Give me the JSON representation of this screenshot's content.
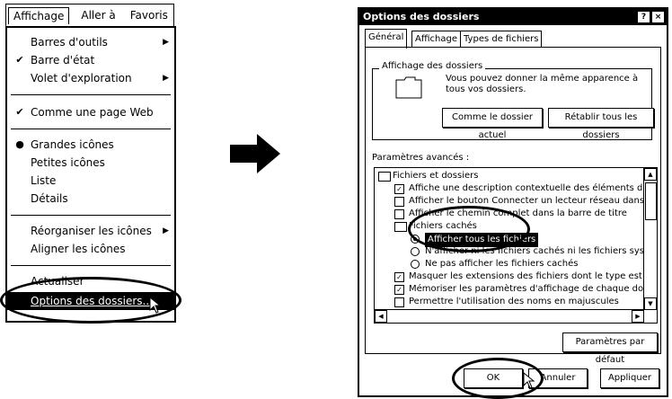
{
  "menubar": {
    "items": [
      "Affichage",
      "Aller à",
      "Favoris"
    ]
  },
  "menu": {
    "items": [
      {
        "label": "Barres d'outils",
        "checked": false,
        "submenu": true
      },
      {
        "label": "Barre d'état",
        "checked": true,
        "submenu": false
      },
      {
        "label": "Volet d'exploration",
        "checked": false,
        "submenu": true
      },
      {
        "label": "Comme une page Web",
        "checked": true,
        "submenu": false
      },
      {
        "label": "Grandes icônes",
        "radio": true,
        "submenu": false
      },
      {
        "label": "Petites icônes",
        "submenu": false
      },
      {
        "label": "Liste",
        "submenu": false
      },
      {
        "label": "Détails",
        "submenu": false
      },
      {
        "label": "Réorganiser les icônes",
        "submenu": true
      },
      {
        "label": "Aligner les icônes",
        "submenu": false
      },
      {
        "label": "Actualiser",
        "submenu": false
      },
      {
        "label": "Options des dossiers...",
        "submenu": false,
        "highlighted": true
      }
    ]
  },
  "dialog": {
    "title": "Options des dossiers",
    "help_button": "?",
    "close_button": "×",
    "tabs": [
      "Général",
      "Affichage",
      "Types de fichiers"
    ],
    "group_title": "Affichage des dossiers",
    "group_text": "Vous pouvez donner la même apparence à tous vos dossiers.",
    "btn_current": "Comme le dossier actuel",
    "btn_reset_all": "Rétablir tous les dossiers",
    "advanced_label": "Paramètres avancés :",
    "tree": [
      {
        "kind": "folder",
        "label": "Fichiers et dossiers",
        "indent": 0
      },
      {
        "kind": "check",
        "checked": true,
        "label": "Affiche une description contextuelle des éléments du Bure",
        "indent": 1
      },
      {
        "kind": "check",
        "checked": false,
        "label": "Afficher le bouton Connecter un lecteur réseau dans la ba",
        "indent": 1
      },
      {
        "kind": "check",
        "checked": false,
        "label": "Afficher le chemin complet dans la barre de titre",
        "indent": 1
      },
      {
        "kind": "folder",
        "label": "Fichiers cachés",
        "indent": 1
      },
      {
        "kind": "radio",
        "on": true,
        "label": "Afficher tous les fichiers",
        "indent": 2,
        "selected": true
      },
      {
        "kind": "radio",
        "on": false,
        "label": "N'afficher ni les fichiers cachés ni les fichiers système",
        "indent": 2
      },
      {
        "kind": "radio",
        "on": false,
        "label": "Ne pas afficher les fichiers cachés",
        "indent": 2
      },
      {
        "kind": "check",
        "checked": true,
        "label": "Masquer les extensions des fichiers dont le type est conn",
        "indent": 1
      },
      {
        "kind": "check",
        "checked": true,
        "label": "Mémoriser les paramètres d'affichage de chaque dossier",
        "indent": 1
      },
      {
        "kind": "check",
        "checked": false,
        "label": "Permettre l'utilisation des noms en majuscules",
        "indent": 1
      }
    ],
    "btn_defaults": "Paramètres par défaut",
    "btn_ok": "OK",
    "btn_cancel": "Annuler",
    "btn_apply": "Appliquer"
  }
}
